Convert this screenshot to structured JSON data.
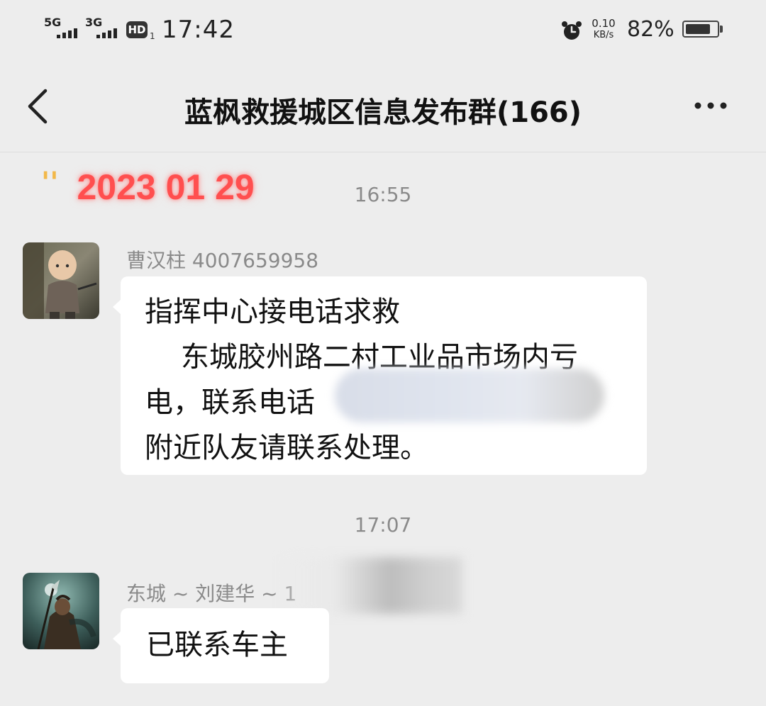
{
  "status_bar": {
    "network1": "5G",
    "network2": "3G",
    "hd_badge": "HD",
    "hd_sub": "1",
    "time": "17:42",
    "speed_value": "0.10",
    "speed_unit": "KB/s",
    "battery_percent": "82%",
    "battery_level": 0.82
  },
  "nav": {
    "title": "蓝枫救援城区信息发布群(166)"
  },
  "date_stamp": {
    "quote": "''",
    "text": "2023 01 29"
  },
  "messages": [
    {
      "time": "16:55",
      "sender": "曹汉柱  4007659958",
      "text": "指挥中心接电话求救\n    东城胶州路二村工业品市场内亏电，联系电话                                  附近队友请联系处理。"
    },
    {
      "time": "17:07",
      "sender": "东城 ~ 刘建华 ~ 1",
      "text": "已联系车主"
    }
  ],
  "colors": {
    "background": "#ededed",
    "bubble": "#ffffff",
    "date_red": "#ff4f4f",
    "quote_yellow": "#f2b84a",
    "muted_text": "#8a8a8a"
  }
}
